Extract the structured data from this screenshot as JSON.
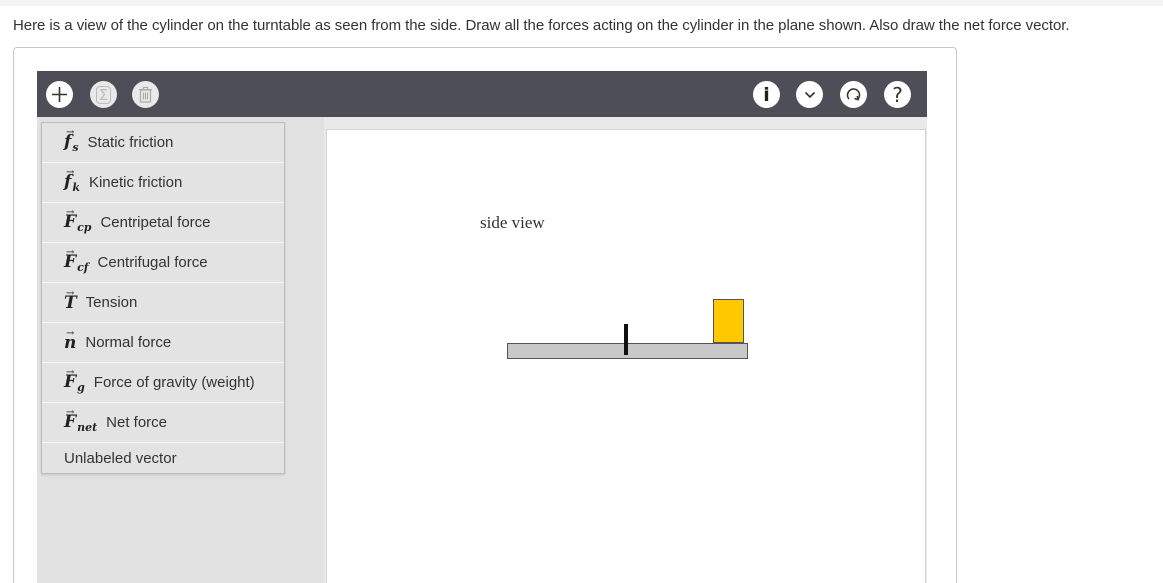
{
  "question": "Here is a view of the cylinder on the turntable as seen from the side. Draw all the forces acting on the cylinder in the plane shown. Also draw the net force vector.",
  "toolbar": {
    "left_icons": [
      "plus-icon",
      "sigma-icon",
      "trash-icon"
    ],
    "right_icons": [
      "info-icon",
      "chevron-down-icon",
      "reset-icon",
      "help-icon"
    ],
    "help_glyph": "?",
    "info_glyph": "i",
    "sigma_glyph": "Σ"
  },
  "menu": {
    "items": [
      {
        "symbol": "f",
        "sub": "s",
        "label": "Static friction"
      },
      {
        "symbol": "f",
        "sub": "k",
        "label": "Kinetic friction"
      },
      {
        "symbol": "F",
        "sub": "cp",
        "label": "Centripetal force"
      },
      {
        "symbol": "F",
        "sub": "cf",
        "label": "Centrifugal force"
      },
      {
        "symbol": "T",
        "sub": "",
        "label": "Tension"
      },
      {
        "symbol": "n",
        "sub": "",
        "label": "Normal force"
      },
      {
        "symbol": "F",
        "sub": "g",
        "label": "Force of gravity (weight)"
      },
      {
        "symbol": "F",
        "sub": "net",
        "label": "Net force"
      },
      {
        "symbol": "",
        "sub": "",
        "label": "Unlabeled vector"
      }
    ]
  },
  "canvas": {
    "label": "side view",
    "cylinder_color": "#ffc800",
    "platform_color": "#c8c8c8"
  },
  "colors": {
    "toolbar": "#4d4e57",
    "panel_bg": "#e6e6e6"
  }
}
